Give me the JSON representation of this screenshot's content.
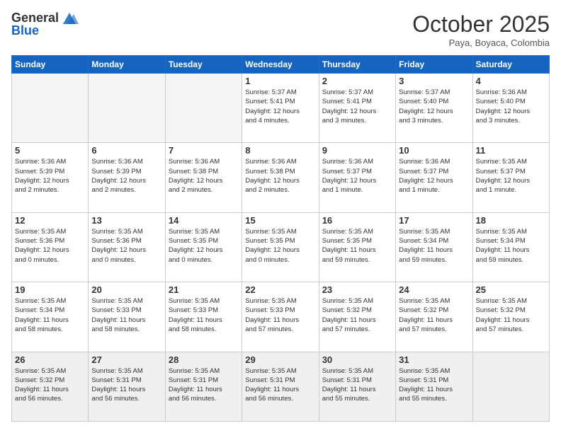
{
  "logo": {
    "general": "General",
    "blue": "Blue"
  },
  "header": {
    "month": "October 2025",
    "location": "Paya, Boyaca, Colombia"
  },
  "weekdays": [
    "Sunday",
    "Monday",
    "Tuesday",
    "Wednesday",
    "Thursday",
    "Friday",
    "Saturday"
  ],
  "weeks": [
    [
      {
        "day": "",
        "info": ""
      },
      {
        "day": "",
        "info": ""
      },
      {
        "day": "",
        "info": ""
      },
      {
        "day": "1",
        "info": "Sunrise: 5:37 AM\nSunset: 5:41 PM\nDaylight: 12 hours\nand 4 minutes."
      },
      {
        "day": "2",
        "info": "Sunrise: 5:37 AM\nSunset: 5:41 PM\nDaylight: 12 hours\nand 3 minutes."
      },
      {
        "day": "3",
        "info": "Sunrise: 5:37 AM\nSunset: 5:40 PM\nDaylight: 12 hours\nand 3 minutes."
      },
      {
        "day": "4",
        "info": "Sunrise: 5:36 AM\nSunset: 5:40 PM\nDaylight: 12 hours\nand 3 minutes."
      }
    ],
    [
      {
        "day": "5",
        "info": "Sunrise: 5:36 AM\nSunset: 5:39 PM\nDaylight: 12 hours\nand 2 minutes."
      },
      {
        "day": "6",
        "info": "Sunrise: 5:36 AM\nSunset: 5:39 PM\nDaylight: 12 hours\nand 2 minutes."
      },
      {
        "day": "7",
        "info": "Sunrise: 5:36 AM\nSunset: 5:38 PM\nDaylight: 12 hours\nand 2 minutes."
      },
      {
        "day": "8",
        "info": "Sunrise: 5:36 AM\nSunset: 5:38 PM\nDaylight: 12 hours\nand 2 minutes."
      },
      {
        "day": "9",
        "info": "Sunrise: 5:36 AM\nSunset: 5:37 PM\nDaylight: 12 hours\nand 1 minute."
      },
      {
        "day": "10",
        "info": "Sunrise: 5:36 AM\nSunset: 5:37 PM\nDaylight: 12 hours\nand 1 minute."
      },
      {
        "day": "11",
        "info": "Sunrise: 5:35 AM\nSunset: 5:37 PM\nDaylight: 12 hours\nand 1 minute."
      }
    ],
    [
      {
        "day": "12",
        "info": "Sunrise: 5:35 AM\nSunset: 5:36 PM\nDaylight: 12 hours\nand 0 minutes."
      },
      {
        "day": "13",
        "info": "Sunrise: 5:35 AM\nSunset: 5:36 PM\nDaylight: 12 hours\nand 0 minutes."
      },
      {
        "day": "14",
        "info": "Sunrise: 5:35 AM\nSunset: 5:35 PM\nDaylight: 12 hours\nand 0 minutes."
      },
      {
        "day": "15",
        "info": "Sunrise: 5:35 AM\nSunset: 5:35 PM\nDaylight: 12 hours\nand 0 minutes."
      },
      {
        "day": "16",
        "info": "Sunrise: 5:35 AM\nSunset: 5:35 PM\nDaylight: 11 hours\nand 59 minutes."
      },
      {
        "day": "17",
        "info": "Sunrise: 5:35 AM\nSunset: 5:34 PM\nDaylight: 11 hours\nand 59 minutes."
      },
      {
        "day": "18",
        "info": "Sunrise: 5:35 AM\nSunset: 5:34 PM\nDaylight: 11 hours\nand 59 minutes."
      }
    ],
    [
      {
        "day": "19",
        "info": "Sunrise: 5:35 AM\nSunset: 5:34 PM\nDaylight: 11 hours\nand 58 minutes."
      },
      {
        "day": "20",
        "info": "Sunrise: 5:35 AM\nSunset: 5:33 PM\nDaylight: 11 hours\nand 58 minutes."
      },
      {
        "day": "21",
        "info": "Sunrise: 5:35 AM\nSunset: 5:33 PM\nDaylight: 11 hours\nand 58 minutes."
      },
      {
        "day": "22",
        "info": "Sunrise: 5:35 AM\nSunset: 5:33 PM\nDaylight: 11 hours\nand 57 minutes."
      },
      {
        "day": "23",
        "info": "Sunrise: 5:35 AM\nSunset: 5:32 PM\nDaylight: 11 hours\nand 57 minutes."
      },
      {
        "day": "24",
        "info": "Sunrise: 5:35 AM\nSunset: 5:32 PM\nDaylight: 11 hours\nand 57 minutes."
      },
      {
        "day": "25",
        "info": "Sunrise: 5:35 AM\nSunset: 5:32 PM\nDaylight: 11 hours\nand 57 minutes."
      }
    ],
    [
      {
        "day": "26",
        "info": "Sunrise: 5:35 AM\nSunset: 5:32 PM\nDaylight: 11 hours\nand 56 minutes."
      },
      {
        "day": "27",
        "info": "Sunrise: 5:35 AM\nSunset: 5:31 PM\nDaylight: 11 hours\nand 56 minutes."
      },
      {
        "day": "28",
        "info": "Sunrise: 5:35 AM\nSunset: 5:31 PM\nDaylight: 11 hours\nand 56 minutes."
      },
      {
        "day": "29",
        "info": "Sunrise: 5:35 AM\nSunset: 5:31 PM\nDaylight: 11 hours\nand 56 minutes."
      },
      {
        "day": "30",
        "info": "Sunrise: 5:35 AM\nSunset: 5:31 PM\nDaylight: 11 hours\nand 55 minutes."
      },
      {
        "day": "31",
        "info": "Sunrise: 5:35 AM\nSunset: 5:31 PM\nDaylight: 11 hours\nand 55 minutes."
      },
      {
        "day": "",
        "info": ""
      }
    ]
  ]
}
